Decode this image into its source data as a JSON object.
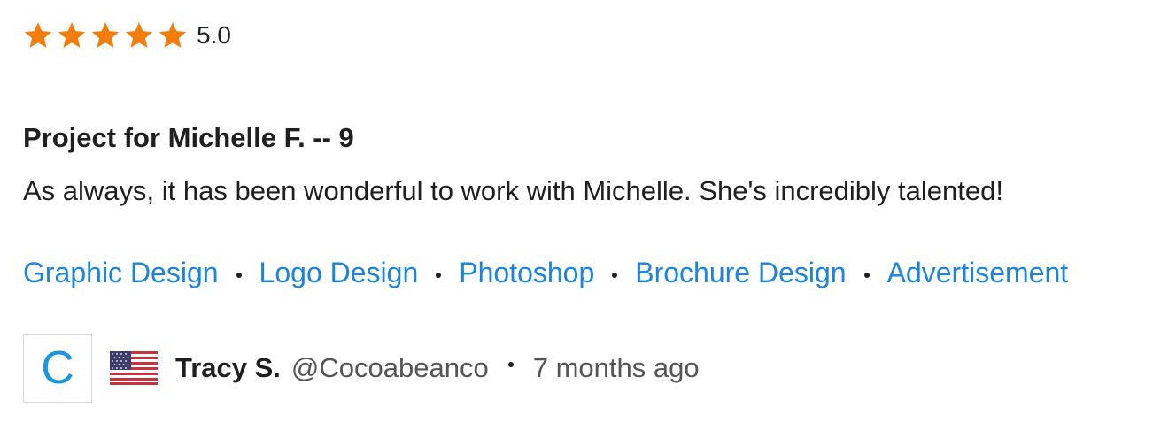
{
  "rating": {
    "stars": 5,
    "max_stars": 5,
    "value_text": "5.0",
    "star_color": "#f27d0c",
    "star_icon": "star-icon"
  },
  "review": {
    "title": "Project for Michelle F. -- 9",
    "body": "As always, it has been wonderful to work with Michelle. She's incredibly talented!"
  },
  "skills": [
    "Graphic Design",
    "Logo Design",
    "Photoshop",
    "Brochure Design",
    "Advertisement"
  ],
  "author": {
    "avatar_letter": "C",
    "flag_icon": "us-flag-icon",
    "name": "Tracy S.",
    "handle": "@Cocoabeanco",
    "time_ago": "7 months ago"
  },
  "colors": {
    "link": "#1a84de",
    "avatar_letter": "#1a95e0",
    "text": "#1f1f1f",
    "muted": "#555555"
  }
}
